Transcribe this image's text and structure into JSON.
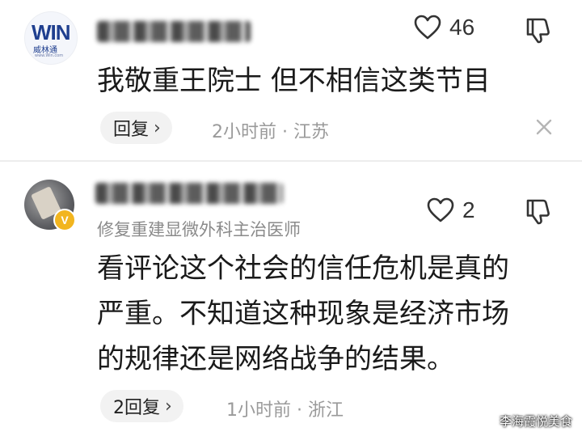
{
  "comments": [
    {
      "avatar_logo": "WIN",
      "avatar_sub": "威林通",
      "avatar_tiny": "www.Win.com",
      "likes": "46",
      "text_lines": [
        "我敬重王院士 但不相信这类节目"
      ],
      "reply_label": "回复",
      "meta": "2小时前 · 江苏"
    },
    {
      "badge": "V",
      "role": "修复重建显微外科主治医师",
      "likes": "2",
      "text_lines": [
        "看评论这个社会的信任危机是真的",
        "严重。不知道这种现象是经济市场",
        "的规律还是网络战争的结果。"
      ],
      "reply_label": "2回复",
      "meta": "1小时前 · 浙江"
    }
  ],
  "icons": {
    "like": "heart-icon",
    "dislike": "thumbs-down-icon",
    "reply_chevron": "chevron-right-icon",
    "dismiss": "close-icon"
  },
  "watermark": "李海霞悦美食"
}
